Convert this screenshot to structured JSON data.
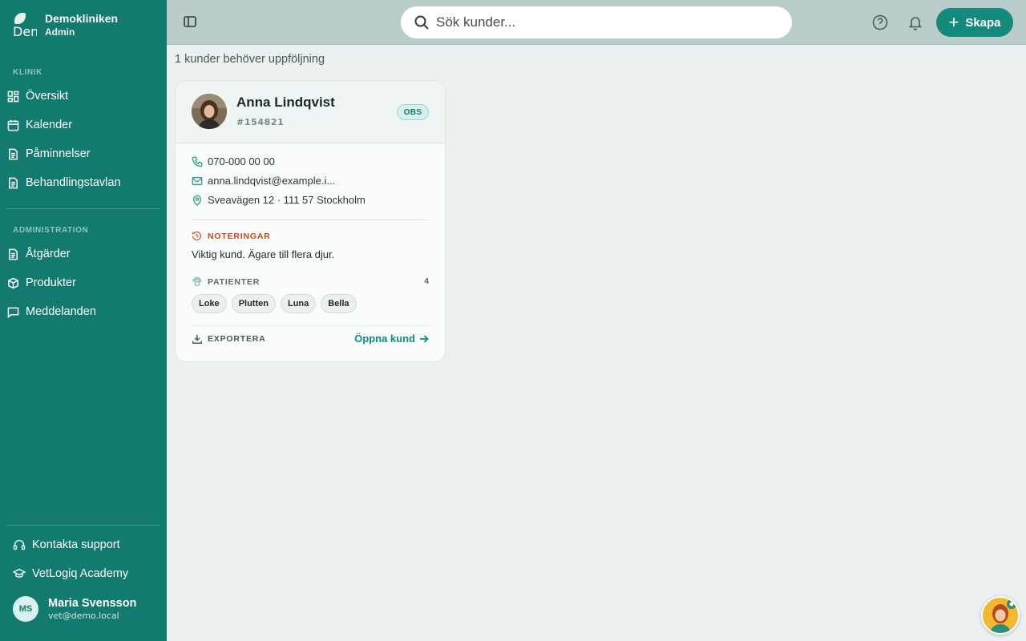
{
  "brand": {
    "name": "Demokliniken",
    "role": "Admin",
    "logo_text": "Dem"
  },
  "sidebar": {
    "sections": [
      {
        "label": "KLINIK",
        "items": [
          {
            "label": "Översikt",
            "icon": "dashboard-icon"
          },
          {
            "label": "Kalender",
            "icon": "calendar-icon"
          },
          {
            "label": "Påminnelser",
            "icon": "document-icon"
          },
          {
            "label": "Behandlingstavlan",
            "icon": "document-icon"
          }
        ]
      },
      {
        "label": "ADMINISTRATION",
        "items": [
          {
            "label": "Åtgärder",
            "icon": "document-icon"
          },
          {
            "label": "Produkter",
            "icon": "box-icon"
          },
          {
            "label": "Meddelanden",
            "icon": "message-icon"
          }
        ]
      }
    ],
    "footer": [
      {
        "label": "Kontakta support",
        "icon": "headset-icon"
      },
      {
        "label": "VetLogiq Academy",
        "icon": "graduation-cap-icon"
      }
    ],
    "user": {
      "initials": "MS",
      "name": "Maria Svensson",
      "email": "vet@demo.local"
    }
  },
  "topbar": {
    "search_placeholder": "Sök kunder...",
    "create_label": "Skapa"
  },
  "main": {
    "summary": "1 kunder behöver uppföljning",
    "card": {
      "name": "Anna Lindqvist",
      "id": "#154821",
      "badge": "OBS",
      "phone": "070-000 00 00",
      "email": "anna.lindqvist@example.i...",
      "address": "Sveavägen 12 · 111 57 Stockholm",
      "notes_label": "NOTERINGAR",
      "notes": "Viktig kund. Ägare till flera djur.",
      "patients_label": "PATIENTER",
      "patients_count": "4",
      "patients": [
        "Loke",
        "Plutten",
        "Luna",
        "Bella"
      ],
      "export_label": "EXPORTERA",
      "open_label": "Öppna kund"
    }
  },
  "colors": {
    "sidebar": "#137a6f",
    "accent": "#138a7c",
    "warning": "#c24a1a",
    "background": "#ebf1f0"
  }
}
